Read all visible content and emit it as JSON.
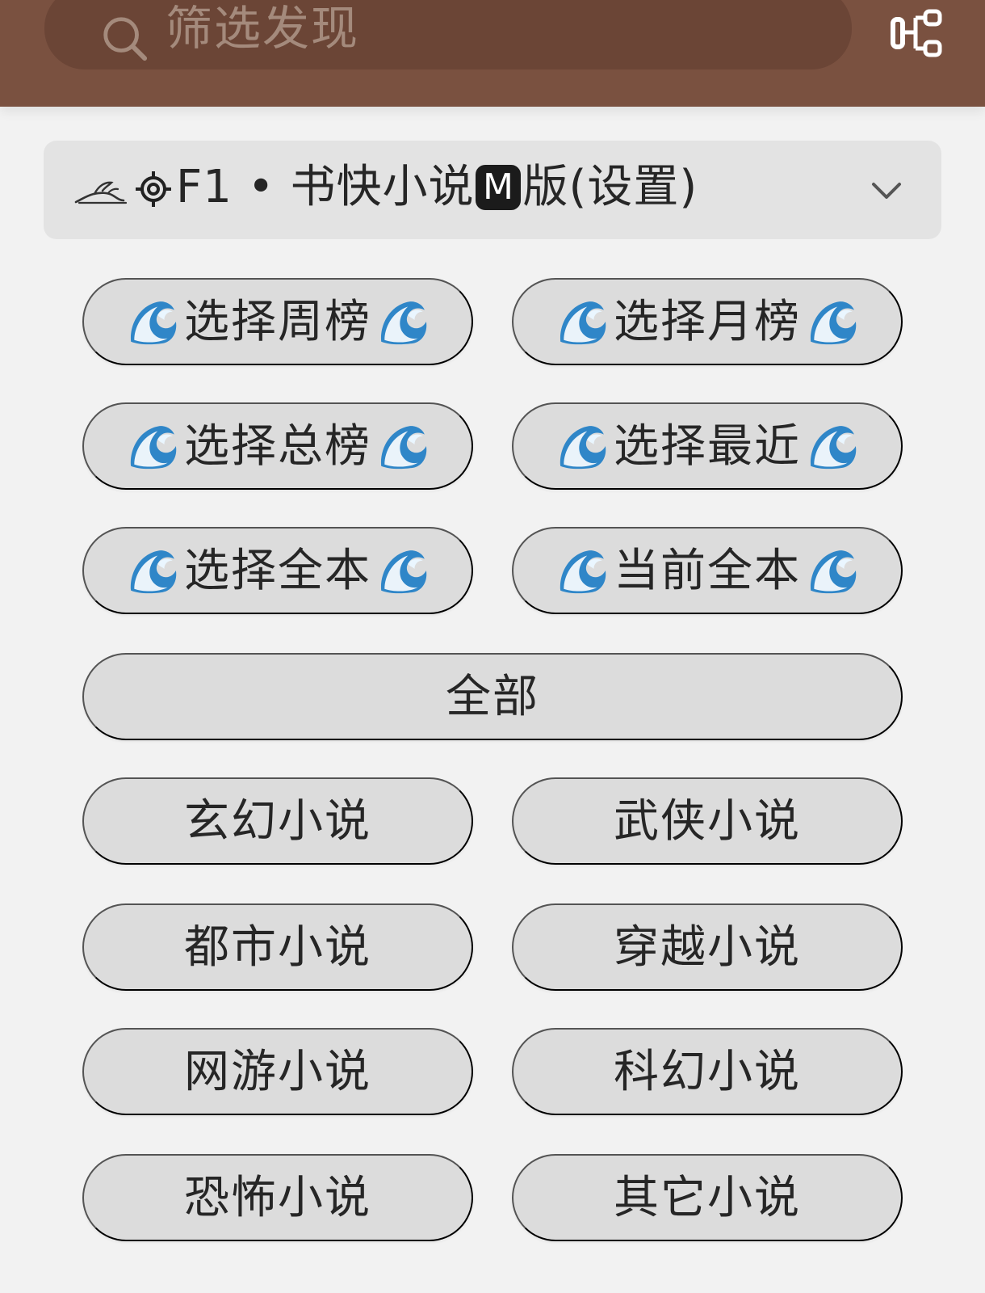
{
  "search": {
    "placeholder": "筛选发现",
    "icon": "search-icon"
  },
  "topbar": {
    "action_icon": "hierarchy-icon"
  },
  "source_selector": {
    "prefix": "F1 • 书快小说",
    "badge": "M",
    "suffix": "版(设置)",
    "icons": [
      "rabbit-icon",
      "gear-icon",
      "chevron-down-icon"
    ]
  },
  "ranking_buttons": [
    {
      "label": "选择周榜",
      "icon": "wave-icon"
    },
    {
      "label": "选择月榜",
      "icon": "wave-icon"
    },
    {
      "label": "选择总榜",
      "icon": "wave-icon"
    },
    {
      "label": "选择最近",
      "icon": "wave-icon"
    },
    {
      "label": "选择全本",
      "icon": "wave-icon"
    },
    {
      "label": "当前全本",
      "icon": "wave-icon"
    }
  ],
  "category_all": {
    "label": "全部"
  },
  "categories": [
    {
      "label": "玄幻小说"
    },
    {
      "label": "武侠小说"
    },
    {
      "label": "都市小说"
    },
    {
      "label": "穿越小说"
    },
    {
      "label": "网游小说"
    },
    {
      "label": "科幻小说"
    },
    {
      "label": "恐怖小说"
    },
    {
      "label": "其它小说"
    }
  ],
  "colors": {
    "topbar": "#7a5140",
    "search_field": "#6b4536",
    "page_background": "#f2f2f2",
    "button_background": "#dcdcdc",
    "text": "#262626"
  }
}
